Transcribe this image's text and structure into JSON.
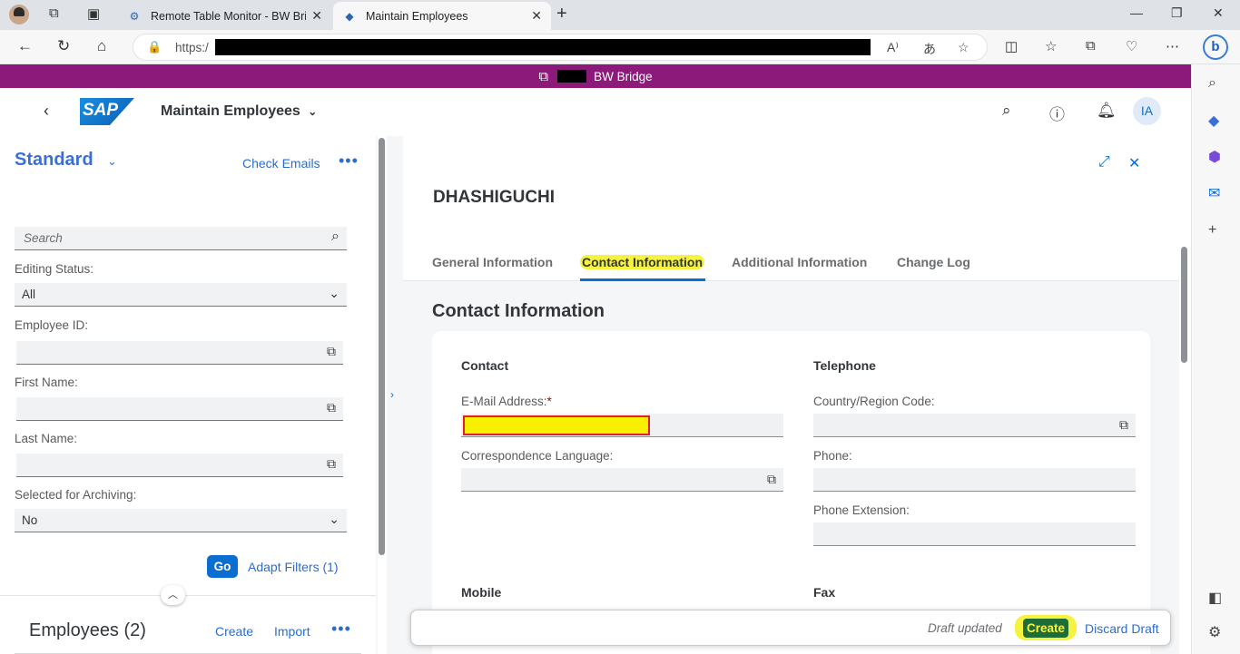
{
  "browser": {
    "tabs": [
      {
        "title": "Remote Table Monitor - BW Brid"
      },
      {
        "title": "Maintain Employees"
      }
    ],
    "url_prefix": "https:/"
  },
  "banner": {
    "text": "BW Bridge"
  },
  "shell": {
    "app_title": "Maintain Employees",
    "user_initials": "IA",
    "logo_text": "SAP"
  },
  "filter": {
    "variant": "Standard",
    "check_emails": "Check Emails",
    "search_placeholder": "Search",
    "editing_status_label": "Editing Status:",
    "editing_status_value": "All",
    "employee_id_label": "Employee ID:",
    "first_name_label": "First Name:",
    "last_name_label": "Last Name:",
    "archiving_label": "Selected for Archiving:",
    "archiving_value": "No",
    "go": "Go",
    "adapt_filters": "Adapt Filters (1)"
  },
  "table": {
    "title": "Employees (2)",
    "create": "Create",
    "import": "Import"
  },
  "object": {
    "title": "DHASHIGUCHI",
    "tabs": [
      "General Information",
      "Contact Information",
      "Additional Information",
      "Change Log"
    ],
    "section_title": "Contact Information",
    "contact_group": "Contact",
    "email_label": "E-Mail Address:",
    "required_mark": "*",
    "language_label": "Correspondence Language:",
    "telephone_group": "Telephone",
    "country_label": "Country/Region Code:",
    "phone_label": "Phone:",
    "extension_label": "Phone Extension:",
    "mobile_group": "Mobile",
    "fax_group": "Fax"
  },
  "footer": {
    "draft_message": "Draft updated",
    "create": "Create",
    "discard": "Discard Draft"
  }
}
